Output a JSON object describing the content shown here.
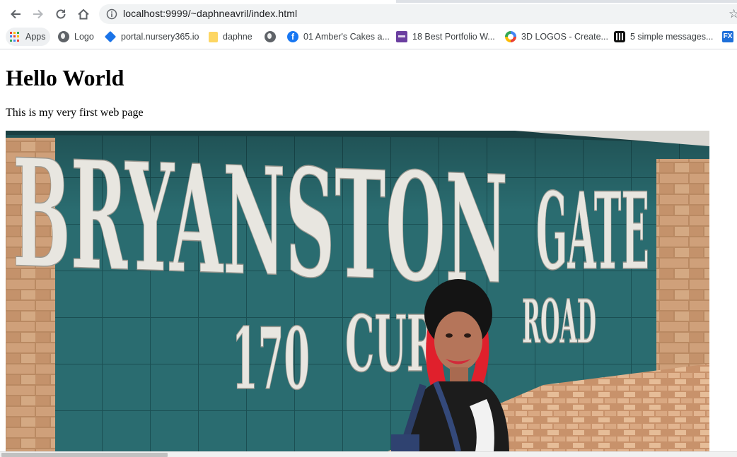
{
  "browser": {
    "url": "localhost:9999/~daphneavril/index.html",
    "nav_icons": [
      "back-arrow-icon",
      "forward-arrow-icon",
      "reload-icon",
      "home-icon"
    ],
    "star_glyph": "☆"
  },
  "bookmarks": [
    {
      "label": "Apps",
      "icon": "apps-grid-icon"
    },
    {
      "label": "Logo",
      "icon": "globe-icon"
    },
    {
      "label": "portal.nursery365.io",
      "icon": "diamond-icon"
    },
    {
      "label": "daphne",
      "icon": "folder-icon"
    },
    {
      "label": "",
      "icon": "globe-icon"
    },
    {
      "label": "01 Amber's Cakes a...",
      "icon": "facebook-icon"
    },
    {
      "label": "18 Best Portfolio W...",
      "icon": "colorlib-icon"
    },
    {
      "label": "3D LOGOS - Create...",
      "icon": "colorful-circle-icon"
    },
    {
      "label": "5 simple messages...",
      "icon": "intercom-icon"
    },
    {
      "label": "",
      "icon": "fx-icon"
    }
  ],
  "bookmark_icon_text": {
    "facebook": "f",
    "fx": "FX"
  },
  "page": {
    "heading": "Hello World",
    "paragraph": "This is my very first web page"
  },
  "photo": {
    "sign_line1": "BRYANSTON GATE",
    "sign_line2_number": "170",
    "sign_line2_street": "CUR",
    "sign_line2_road": "ROAD",
    "sign_words": [
      "BRYANSTON",
      "GATE"
    ]
  },
  "colors": {
    "sign_teal": "#2a6c70",
    "sign_letters": "#e8e6e0",
    "brick": "#c79a72",
    "paving": "#d9a882",
    "hair_red": "#e0202c"
  }
}
